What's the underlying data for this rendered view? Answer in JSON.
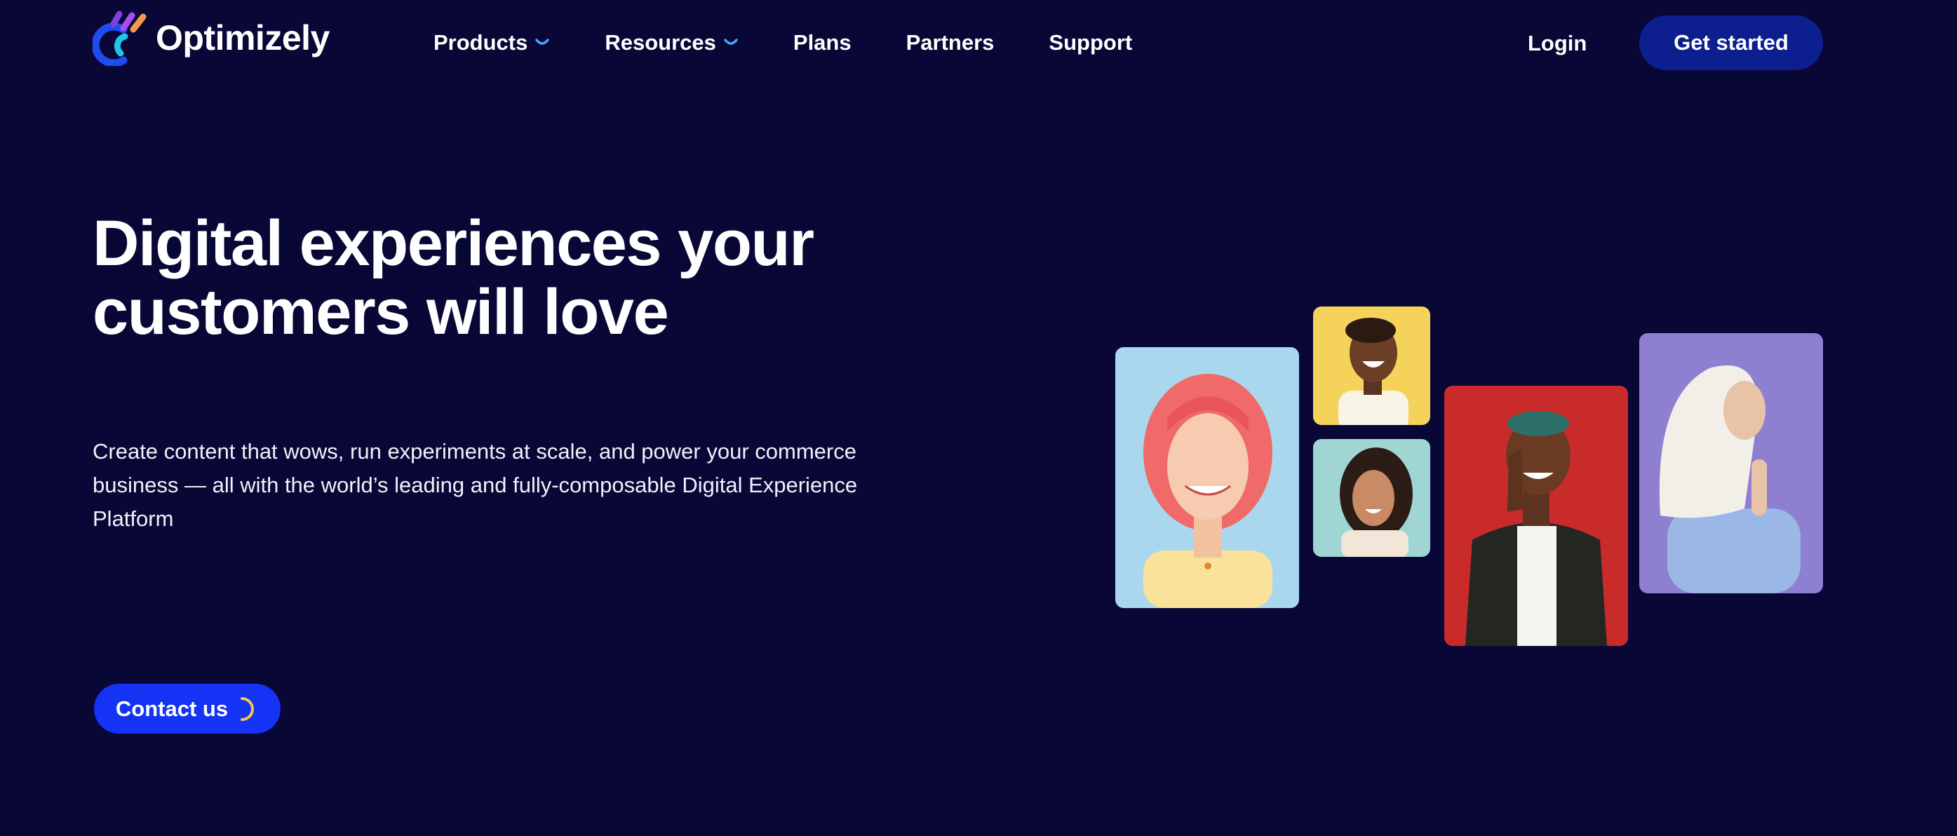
{
  "brand": {
    "name": "Optimizely",
    "logo_icon": "optimizely-logo-icon",
    "colors": {
      "background": "#080736",
      "primary_button": "#1433f5",
      "header_button": "#0d1e8f",
      "chevron": "#4aa3ff",
      "spinner": "#f2c94c"
    }
  },
  "nav": {
    "items": [
      {
        "label": "Products",
        "has_dropdown": true,
        "icon": "chevron-down-icon"
      },
      {
        "label": "Resources",
        "has_dropdown": true,
        "icon": "chevron-down-icon"
      },
      {
        "label": "Plans",
        "has_dropdown": false
      },
      {
        "label": "Partners",
        "has_dropdown": false
      },
      {
        "label": "Support",
        "has_dropdown": false
      }
    ],
    "login_label": "Login",
    "cta_label": "Get started"
  },
  "hero": {
    "title_line1": "Digital experiences your",
    "title_line2": "customers will love",
    "subtitle": "Create content that wows, run experiments at scale, and power your commerce business — all with the world’s leading and fully-composable Digital Experience Platform",
    "contact_label": "Contact us",
    "contact_icon": "loading-spinner-icon"
  },
  "photos": [
    {
      "name": "photo-pink-hair-woman",
      "background": "#a9d8ee"
    },
    {
      "name": "photo-laughing-woman-yellow",
      "background": "#f5d35a"
    },
    {
      "name": "photo-smiling-woman-teal",
      "background": "#9fd6d3"
    },
    {
      "name": "photo-laughing-man-red",
      "background": "#c92b2b"
    },
    {
      "name": "photo-woman-hijab-purple",
      "background": "#8f7fd0"
    }
  ]
}
